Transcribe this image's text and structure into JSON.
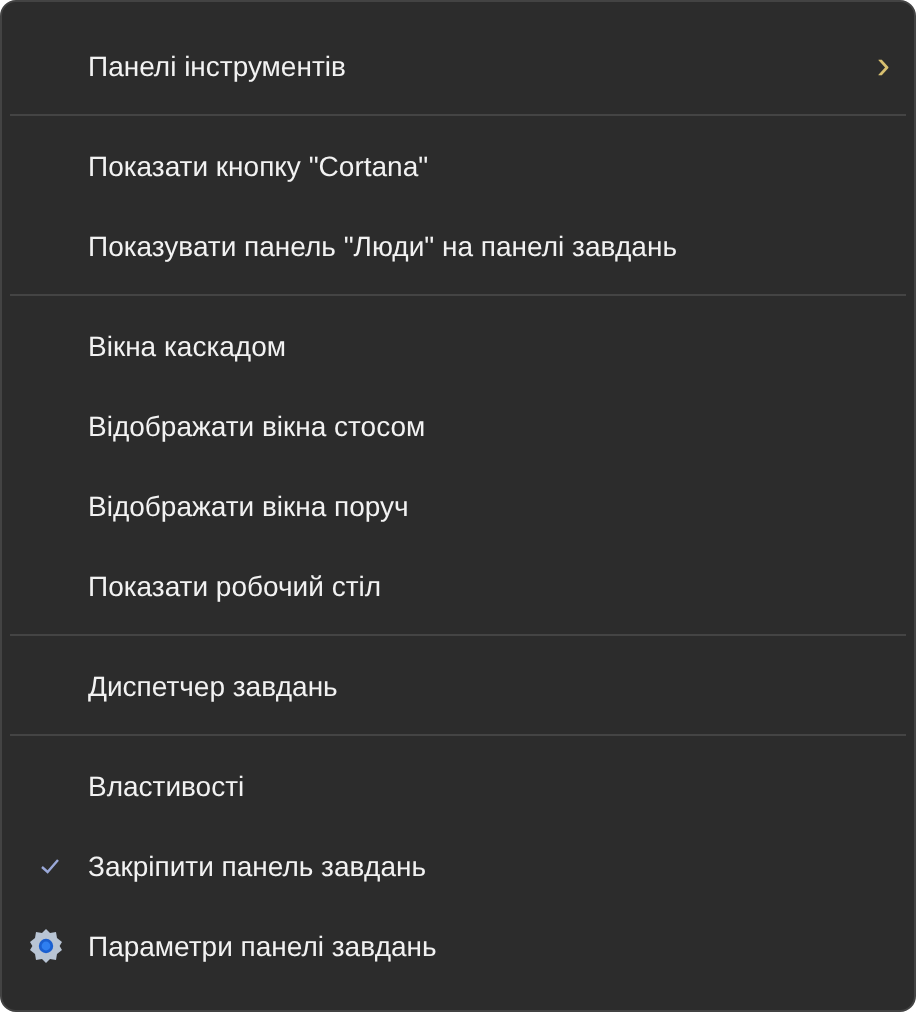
{
  "menu": {
    "groups": [
      {
        "items": [
          {
            "label": "Панелі інструментів",
            "kind": "submenu",
            "checked": false,
            "arrow": "›"
          }
        ]
      },
      {
        "items": [
          {
            "label": "Показати кнопку \"Cortana\"",
            "kind": "plain",
            "checked": false
          },
          {
            "label": "Показувати панель \"Люди\" на панелі завдань",
            "kind": "plain",
            "checked": false
          }
        ]
      },
      {
        "items": [
          {
            "label": "Вікна каскадом",
            "kind": "plain",
            "checked": false
          },
          {
            "label": "Відображати вікна стосом",
            "kind": "plain",
            "checked": false
          },
          {
            "label": "Відображати вікна поруч",
            "kind": "plain",
            "checked": false
          },
          {
            "label": "Показати робочий стіл",
            "kind": "plain",
            "checked": false
          }
        ]
      },
      {
        "items": [
          {
            "label": "Диспетчер завдань",
            "kind": "plain",
            "checked": false
          }
        ]
      },
      {
        "items": [
          {
            "label": "Властивості",
            "kind": "plain",
            "checked": false
          },
          {
            "label": "Закріпити панель завдань",
            "kind": "check",
            "checked": true
          },
          {
            "label": "Параметри панелі завдань",
            "kind": "settings",
            "checked": false
          }
        ]
      }
    ]
  }
}
